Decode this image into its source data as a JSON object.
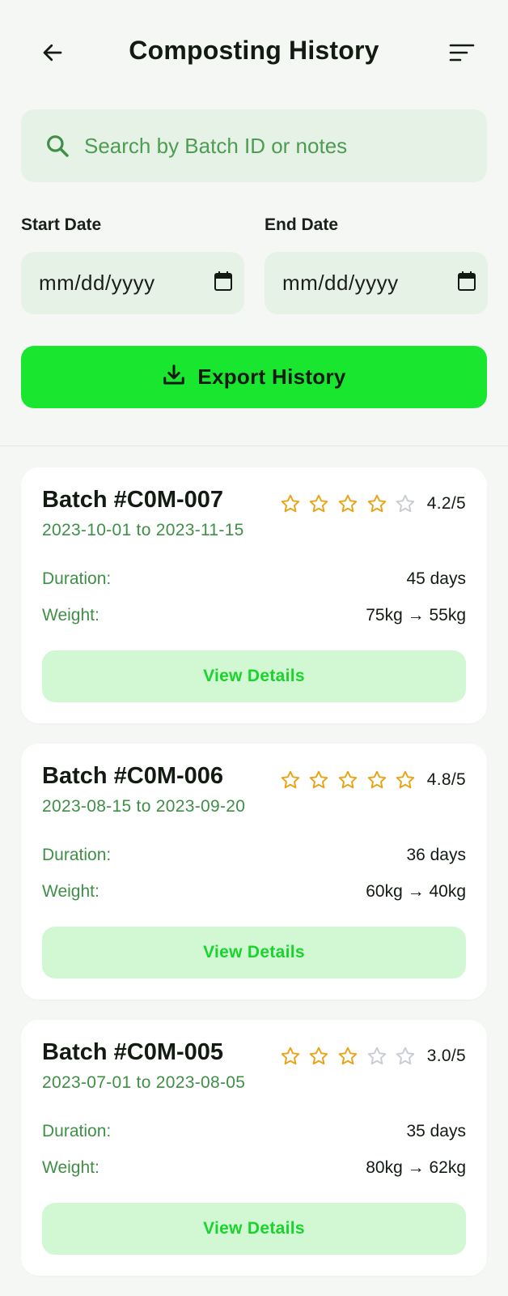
{
  "header": {
    "title": "Composting History",
    "back_icon": "arrow-left-icon",
    "sort_icon": "sort-icon"
  },
  "search": {
    "placeholder": "Search by Batch ID or notes",
    "value": "",
    "icon": "search-icon"
  },
  "filters": {
    "start_label": "Start Date",
    "start_value": "mm/dd/yyyy",
    "end_label": "End Date",
    "end_value": "mm/dd/yyyy",
    "calendar_icon": "calendar-icon"
  },
  "export": {
    "label": "Export History",
    "icon": "download-icon"
  },
  "colors": {
    "accent": "#19e62e",
    "accent_soft": "#d2f8d3",
    "secondary_text": "#3f8f46",
    "star_filled": "#e8a317",
    "star_empty": "#c9ccd3"
  },
  "batches": [
    {
      "title": "Batch #C0M-007",
      "dates": "2023-10-01 to 2023-11-15",
      "stars_filled": 4,
      "rating_text": "4.2/5",
      "duration_label": "Duration:",
      "duration_value": "45 days",
      "weight_label": "Weight:",
      "weight_value": "75kg → 55kg",
      "button_label": "View Details"
    },
    {
      "title": "Batch #C0M-006",
      "dates": "2023-08-15 to 2023-09-20",
      "stars_filled": 5,
      "rating_text": "4.8/5",
      "duration_label": "Duration:",
      "duration_value": "36 days",
      "weight_label": "Weight:",
      "weight_value": "60kg → 40kg",
      "button_label": "View Details"
    },
    {
      "title": "Batch #C0M-005",
      "dates": "2023-07-01 to 2023-08-05",
      "stars_filled": 3,
      "rating_text": "3.0/5",
      "duration_label": "Duration:",
      "duration_value": "35 days",
      "weight_label": "Weight:",
      "weight_value": "80kg → 62kg",
      "button_label": "View Details"
    }
  ]
}
